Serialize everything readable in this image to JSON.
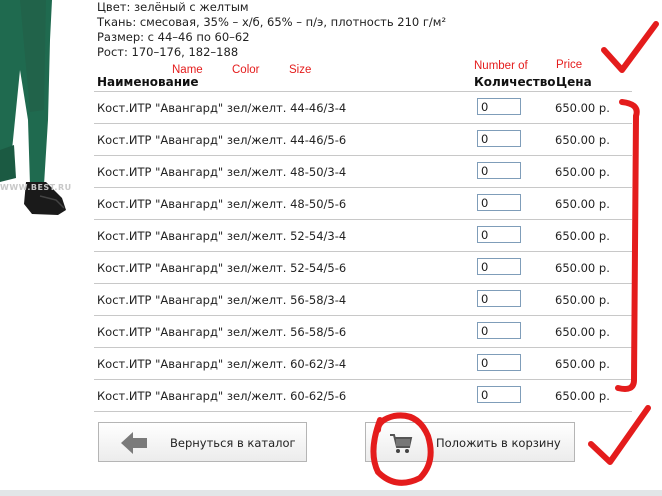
{
  "product": {
    "specs": [
      "Цвет: зелёный с желтым",
      "Ткань: смесовая, 35% – х/б, 65% – п/э, плотность 210 г/м²",
      "Размер: с 44–46 по 60–62",
      "Рост: 170–176, 182–188"
    ],
    "watermark": "WWW.BEST.RU"
  },
  "annotations": {
    "name": "Name",
    "color": "Color",
    "size": "Size",
    "quantity": "Number of",
    "price": "Price",
    "annotation_color": "#e41c1c"
  },
  "table": {
    "headers": {
      "name": "Наименование",
      "quantity": "Количество",
      "price": "Цена"
    },
    "rows": [
      {
        "name": "Кост.ИТР \"Авангард\" зел/желт. 44-46/3-4",
        "qty": "0",
        "price": "650.00 р."
      },
      {
        "name": "Кост.ИТР \"Авангард\" зел/желт. 44-46/5-6",
        "qty": "0",
        "price": "650.00 р."
      },
      {
        "name": "Кост.ИТР \"Авангард\" зел/желт. 48-50/3-4",
        "qty": "0",
        "price": "650.00 р."
      },
      {
        "name": "Кост.ИТР \"Авангард\" зел/желт. 48-50/5-6",
        "qty": "0",
        "price": "650.00 р."
      },
      {
        "name": "Кост.ИТР \"Авангард\" зел/желт. 52-54/3-4",
        "qty": "0",
        "price": "650.00 р."
      },
      {
        "name": "Кост.ИТР \"Авангард\" зел/желт. 52-54/5-6",
        "qty": "0",
        "price": "650.00 р."
      },
      {
        "name": "Кост.ИТР \"Авангард\" зел/желт. 56-58/3-4",
        "qty": "0",
        "price": "650.00 р."
      },
      {
        "name": "Кост.ИТР \"Авангард\" зел/желт. 56-58/5-6",
        "qty": "0",
        "price": "650.00 р."
      },
      {
        "name": "Кост.ИТР \"Авангард\" зел/желт. 60-62/3-4",
        "qty": "0",
        "price": "650.00 р."
      },
      {
        "name": "Кост.ИТР \"Авангард\" зел/желт. 60-62/5-6",
        "qty": "0",
        "price": "650.00 р."
      }
    ]
  },
  "buttons": {
    "back": {
      "label": "Вернуться в каталог",
      "icon": "arrow-left-icon"
    },
    "cart": {
      "label": "Положить в корзину",
      "icon": "shopping-cart-icon"
    }
  }
}
